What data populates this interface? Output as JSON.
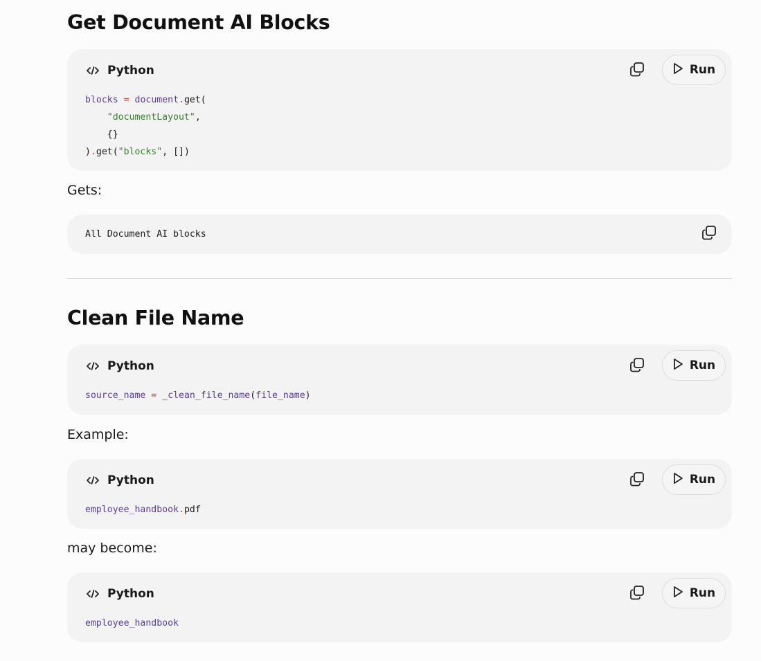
{
  "sections": [
    {
      "title": "Get Document AI Blocks",
      "code_block": {
        "language": "Python",
        "run_label": "Run",
        "lines": [
          [
            {
              "t": "v",
              "s": "blocks"
            },
            {
              "t": "p",
              "s": " "
            },
            {
              "t": "o",
              "s": "="
            },
            {
              "t": "p",
              "s": " "
            },
            {
              "t": "v",
              "s": "document"
            },
            {
              "t": "o",
              "s": "."
            },
            {
              "t": "p",
              "s": "get("
            }
          ],
          [
            {
              "t": "p",
              "s": "    "
            },
            {
              "t": "s",
              "s": "\"documentLayout\""
            },
            {
              "t": "p",
              "s": ","
            }
          ],
          [
            {
              "t": "p",
              "s": "    {}"
            }
          ],
          [
            {
              "t": "p",
              "s": ")"
            },
            {
              "t": "o",
              "s": "."
            },
            {
              "t": "p",
              "s": "get("
            },
            {
              "t": "s",
              "s": "\"blocks\""
            },
            {
              "t": "p",
              "s": ", [])"
            }
          ]
        ]
      },
      "after_text": "Gets:",
      "plain_block": "All Document AI blocks"
    },
    {
      "title": "Clean File Name",
      "code_block": {
        "language": "Python",
        "run_label": "Run",
        "lines": [
          [
            {
              "t": "v",
              "s": "source_name"
            },
            {
              "t": "p",
              "s": " "
            },
            {
              "t": "o",
              "s": "="
            },
            {
              "t": "p",
              "s": " "
            },
            {
              "t": "v",
              "s": "_clean_file_name"
            },
            {
              "t": "p",
              "s": "("
            },
            {
              "t": "v",
              "s": "file_name"
            },
            {
              "t": "p",
              "s": ")"
            }
          ]
        ]
      },
      "after_text": "Example:",
      "example_block": {
        "language": "Python",
        "run_label": "Run",
        "lines": [
          [
            {
              "t": "v",
              "s": "employee_handbook"
            },
            {
              "t": "o",
              "s": "."
            },
            {
              "t": "p",
              "s": "pdf"
            }
          ]
        ]
      },
      "after_text_2": "may become:",
      "result_block": {
        "language": "Python",
        "run_label": "Run",
        "lines": [
          [
            {
              "t": "v",
              "s": "employee_handbook"
            }
          ]
        ]
      }
    }
  ],
  "colors": {
    "background": "#fcfcfc",
    "block_background": "#f3f3f3",
    "variable": "#5b3d99",
    "string": "#3e7a35",
    "operator": "#c2432f",
    "divider": "#d6d6d6"
  },
  "icons": {
    "language": "code-icon",
    "copy": "copy-icon",
    "run": "play-icon"
  }
}
